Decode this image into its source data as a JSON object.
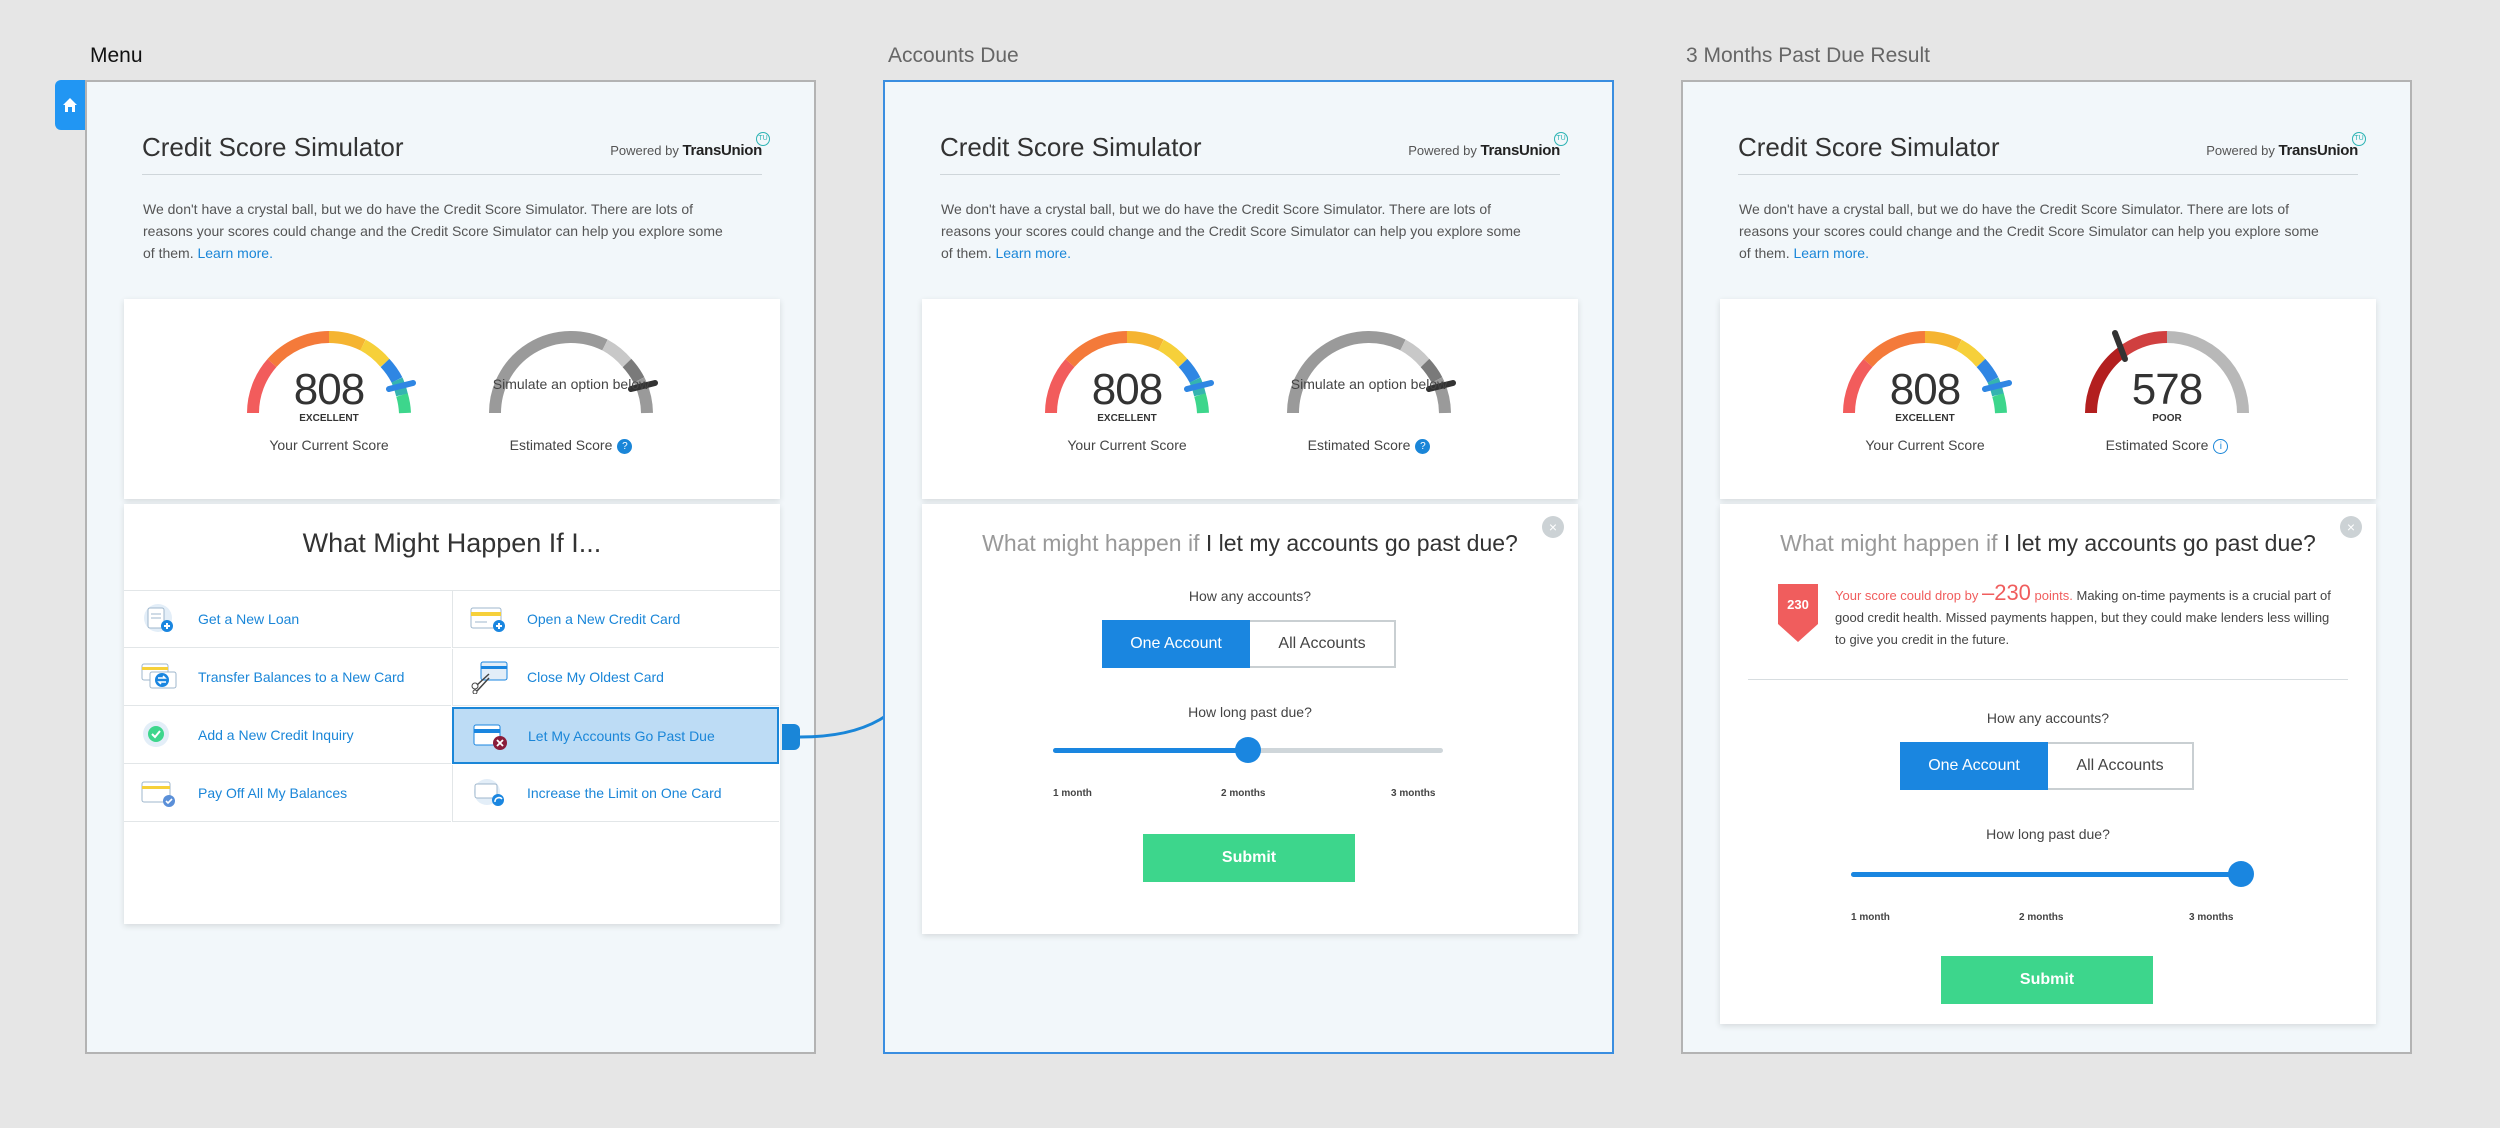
{
  "frames": {
    "menu": {
      "label": "Menu",
      "header_title": "Credit Score Simulator",
      "powered_by": "Powered by",
      "brand": "TransUnion",
      "badge": "TU",
      "intro": "We don't have a crystal ball, but we do have the Credit Score Simulator. There are lots of reasons your scores could change and the Credit Score Simulator can help you explore some of them.",
      "learn_more": "Learn more.",
      "current_score": "808",
      "current_rating": "EXCELLENT",
      "current_caption": "Your Current Score",
      "estimate_text": "Simulate an option below",
      "estimate_caption": "Estimated Score",
      "help": "?",
      "menu_title": "What Might Happen If I...",
      "items": [
        {
          "label": "Get a New Loan",
          "icon": "loan-icon"
        },
        {
          "label": "Open a New Credit Card",
          "icon": "new-card-icon"
        },
        {
          "label": "Transfer Balances to a New Card",
          "icon": "transfer-icon"
        },
        {
          "label": "Close My Oldest Card",
          "icon": "scissors-card-icon"
        },
        {
          "label": "Add a New Credit Inquiry",
          "icon": "inquiry-icon"
        },
        {
          "label": "Let My Accounts Go Past Due",
          "icon": "past-due-icon"
        },
        {
          "label": "Pay Off All My Balances",
          "icon": "payoff-icon"
        },
        {
          "label": "Increase the Limit on One Card",
          "icon": "limit-icon"
        }
      ]
    },
    "due": {
      "label": "Accounts Due",
      "header_title": "Credit Score Simulator",
      "powered_by": "Powered by",
      "brand": "TransUnion",
      "badge": "TU",
      "intro": "We don't have a crystal ball, but we do have the Credit Score Simulator. There are lots of reasons your scores could change and the Credit Score Simulator can help you explore some of them.",
      "learn_more": "Learn more.",
      "current_score": "808",
      "current_rating": "EXCELLENT",
      "current_caption": "Your Current Score",
      "estimate_text": "Simulate an option below",
      "estimate_caption": "Estimated Score",
      "help": "?",
      "close": "×",
      "q_prefix": "What might happen if",
      "q_bold": "I let my accounts go past due?",
      "accounts_label": "How any accounts?",
      "one_account": "One Account",
      "all_accounts": "All Accounts",
      "past_due_label": "How long past due?",
      "ticks": [
        "1 month",
        "2 months",
        "3 months"
      ],
      "slider_value": 0.5,
      "submit": "Submit"
    },
    "result": {
      "label": "3 Months Past Due Result",
      "header_title": "Credit Score Simulator",
      "powered_by": "Powered by",
      "brand": "TransUnion",
      "badge": "TU",
      "intro": "We don't have a crystal ball, but we do have the Credit Score Simulator. There are lots of reasons your scores could change and the Credit Score Simulator can help you explore some of them.",
      "learn_more": "Learn more.",
      "current_score": "808",
      "current_rating": "EXCELLENT",
      "current_caption": "Your Current Score",
      "estimated_score": "578",
      "estimated_rating": "POOR",
      "estimate_caption": "Estimated Score",
      "info": "i",
      "close": "×",
      "q_prefix": "What might happen if",
      "q_bold": "I let my accounts go past due?",
      "drop_badge": "230",
      "drop_pre": "Your score could drop by",
      "drop_value": "–230",
      "drop_post": "points.",
      "drop_body": "Making on-time payments is a crucial part of good credit health. Missed payments happen, but they could make lenders less willing to give you credit in the future.",
      "accounts_label": "How any accounts?",
      "one_account": "One Account",
      "all_accounts": "All Accounts",
      "past_due_label": "How long past due?",
      "ticks": [
        "1 month",
        "2 months",
        "3 months"
      ],
      "slider_value": 1.0,
      "submit": "Submit"
    }
  },
  "colors": {
    "accent": "#1a86e0",
    "submit": "#3dd68c",
    "danger": "#f05d5d",
    "gauge_gray": "#9a9a9a",
    "gauge_poor": "#b31f1f"
  }
}
